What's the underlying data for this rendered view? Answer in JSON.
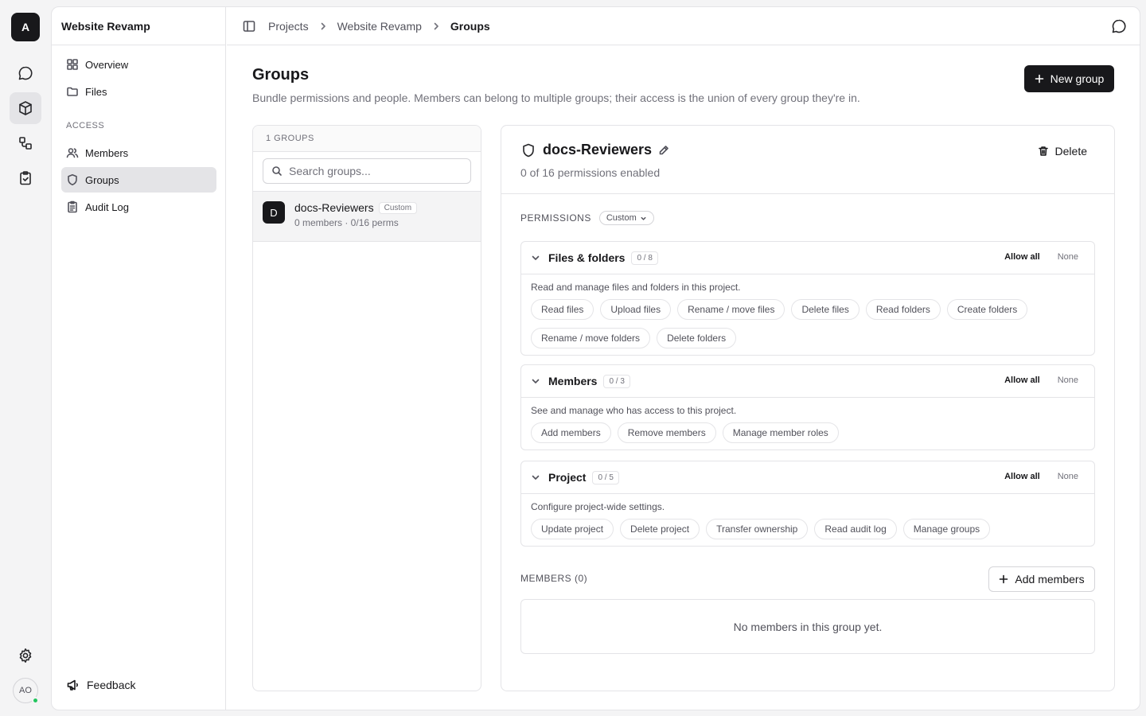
{
  "rail": {
    "logo": "A",
    "items": [
      {
        "icon": "chat-icon",
        "active": false
      },
      {
        "icon": "box-icon",
        "active": true
      },
      {
        "icon": "workflow-icon",
        "active": false
      },
      {
        "icon": "clipboard-check-icon",
        "active": false
      }
    ],
    "settings_icon": "gear-icon",
    "avatar": "AO"
  },
  "sidebar": {
    "project_title": "Website Revamp",
    "items": [
      {
        "label": "Overview",
        "icon": "dashboard-icon"
      },
      {
        "label": "Files",
        "icon": "folder-icon"
      }
    ],
    "section_label": "ACCESS",
    "access_items": [
      {
        "label": "Members",
        "icon": "users-icon"
      },
      {
        "label": "Groups",
        "icon": "shield-icon",
        "active": true
      },
      {
        "label": "Audit Log",
        "icon": "clipboard-list-icon"
      }
    ],
    "feedback_label": "Feedback"
  },
  "breadcrumb": [
    "Projects",
    "Website Revamp",
    "Groups"
  ],
  "page": {
    "title": "Groups",
    "subtitle": "Bundle permissions and people. Members can belong to multiple groups; their access is the union of every group they're in.",
    "new_group_label": "New group"
  },
  "groups_list": {
    "count_label": "1 GROUPS",
    "search_placeholder": "Search groups...",
    "items": [
      {
        "initial": "D",
        "name": "docs-Reviewers",
        "tag": "Custom",
        "meta": "0 members · 0/16 perms"
      }
    ]
  },
  "detail": {
    "name": "docs-Reviewers",
    "perm_summary": "0 of 16 permissions enabled",
    "delete_label": "Delete",
    "permissions_label": "PERMISSIONS",
    "permissions_mode": "Custom",
    "allow_all_label": "Allow all",
    "none_label": "None",
    "groups": [
      {
        "title": "Files & folders",
        "count": "0 / 8",
        "description": "Read and manage files and folders in this project.",
        "perms": [
          "Read files",
          "Upload files",
          "Rename / move files",
          "Delete files",
          "Read folders",
          "Create folders",
          "Rename / move folders",
          "Delete folders"
        ]
      },
      {
        "title": "Members",
        "count": "0 / 3",
        "description": "See and manage who has access to this project.",
        "perms": [
          "Add members",
          "Remove members",
          "Manage member roles"
        ]
      },
      {
        "title": "Project",
        "count": "0 / 5",
        "description": "Configure project-wide settings.",
        "perms": [
          "Update project",
          "Delete project",
          "Transfer ownership",
          "Read audit log",
          "Manage groups"
        ]
      }
    ],
    "members_label": "MEMBERS (0)",
    "add_members_label": "Add members",
    "empty_members": "No members in this group yet."
  }
}
